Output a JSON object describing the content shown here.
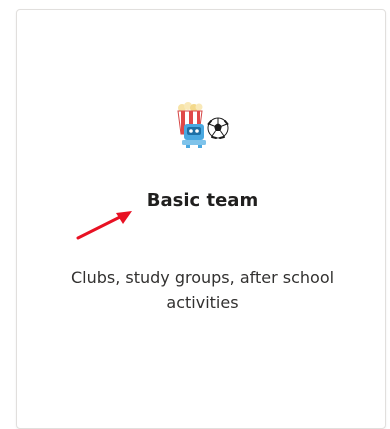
{
  "card": {
    "title": "Basic team",
    "description": "Clubs, study groups, after school activities"
  },
  "icons": {
    "team": "popcorn-soccer-ball-icon",
    "annotation": "red-arrow-icon"
  },
  "colors": {
    "border": "#e1dfdd",
    "title": "#201f1e",
    "description": "#323130",
    "arrow": "#e81123"
  }
}
